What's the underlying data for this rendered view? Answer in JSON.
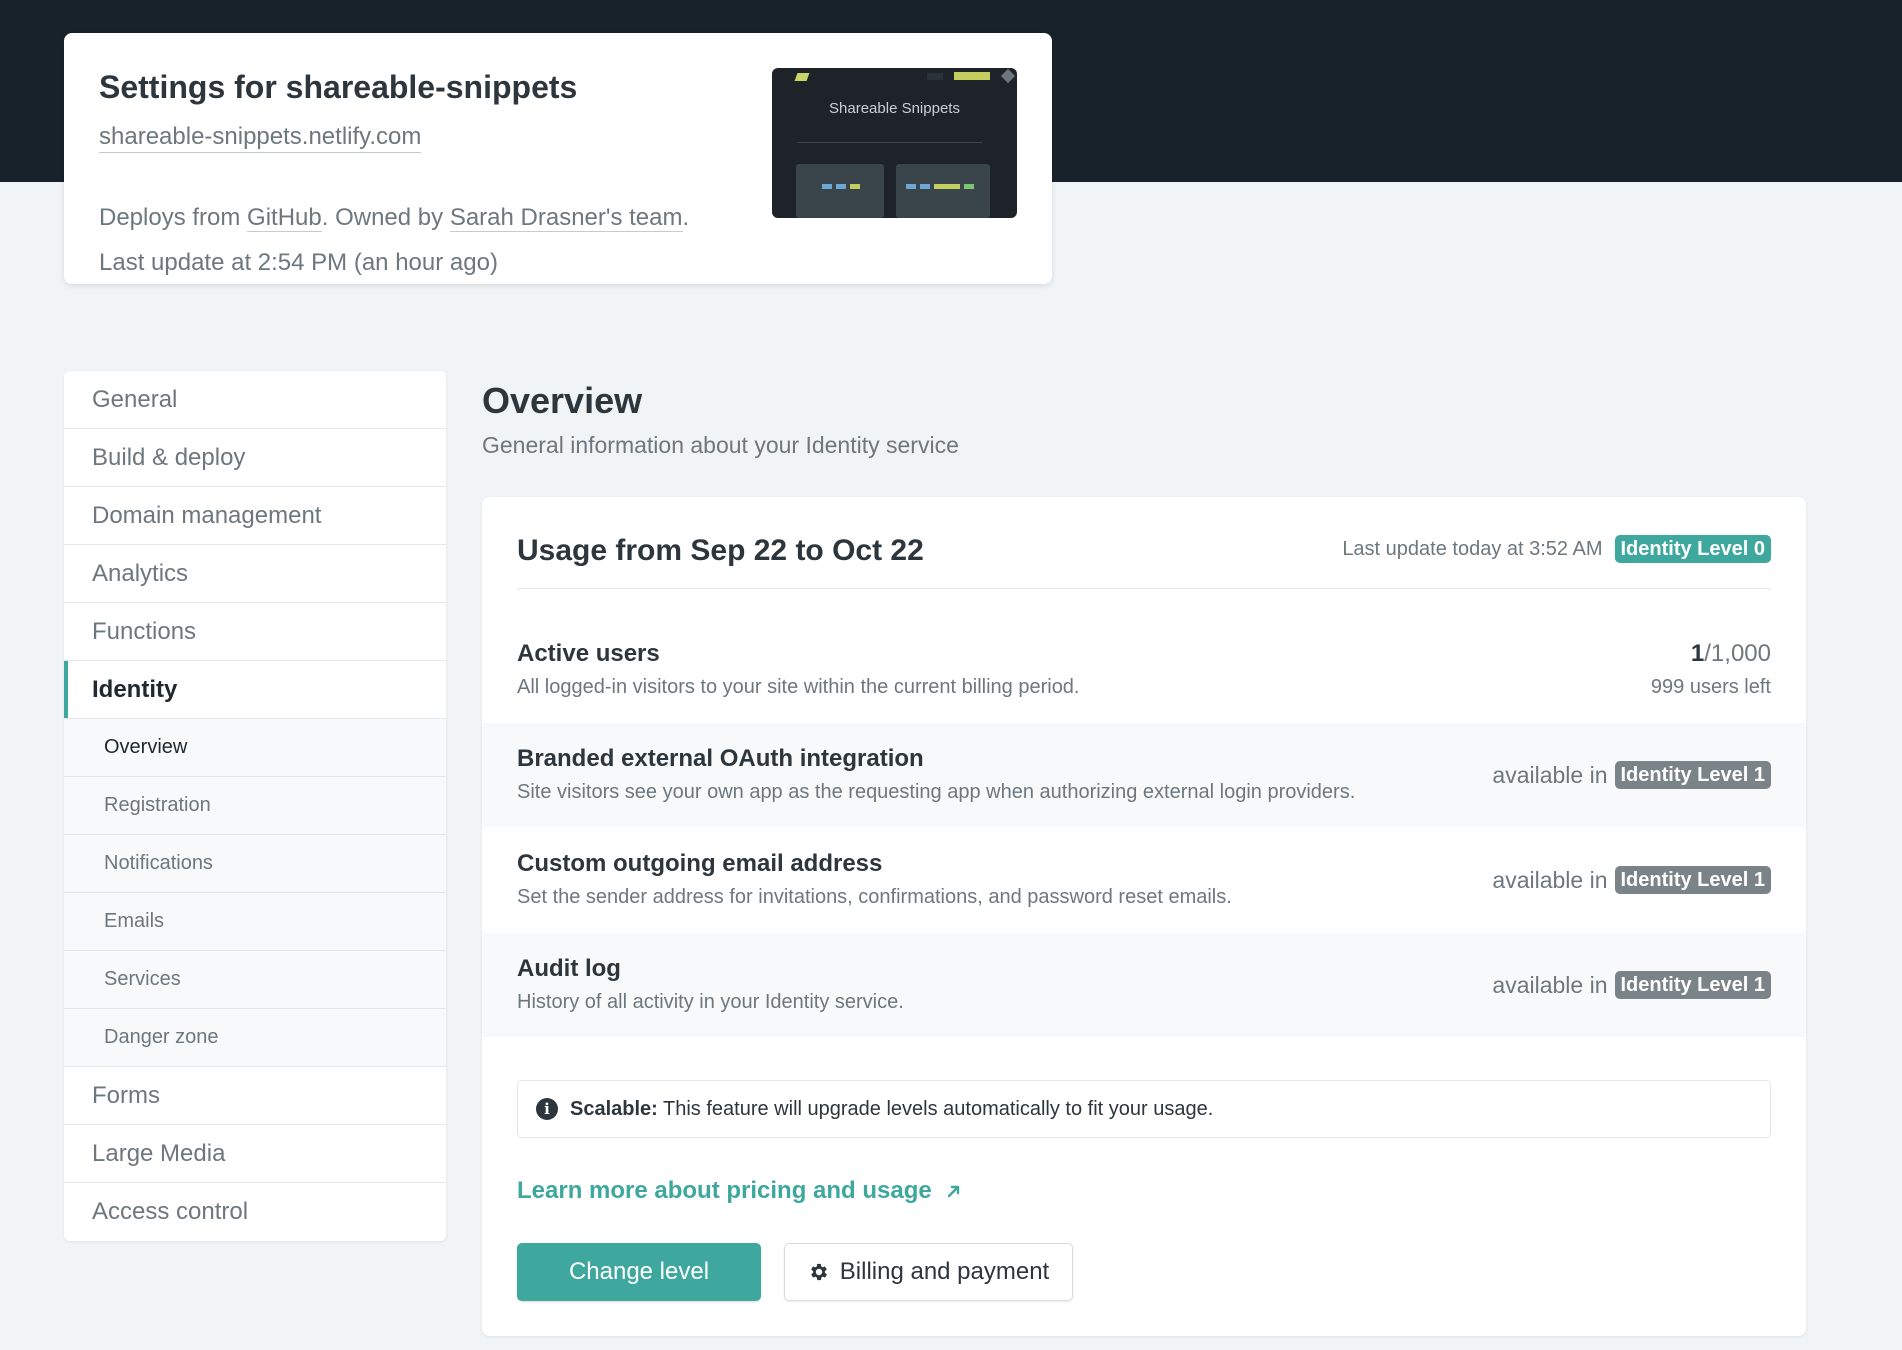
{
  "site": {
    "title": "Settings for shareable-snippets",
    "url": "shareable-snippets.netlify.com",
    "deploys_prefix": "Deploys from ",
    "deploys_source": "GitHub",
    "owned_prefix": ". Owned by ",
    "owner": "Sarah Drasner's team",
    "owned_suffix": ".",
    "last_update": "Last update at 2:54 PM (an hour ago)",
    "thumbnail": {
      "title": "Shareable Snippets"
    }
  },
  "sidebar": {
    "items": [
      {
        "label": "General"
      },
      {
        "label": "Build & deploy"
      },
      {
        "label": "Domain management"
      },
      {
        "label": "Analytics"
      },
      {
        "label": "Functions"
      },
      {
        "label": "Identity"
      }
    ],
    "sub_items": [
      {
        "label": "Overview"
      },
      {
        "label": "Registration"
      },
      {
        "label": "Notifications"
      },
      {
        "label": "Emails"
      },
      {
        "label": "Services"
      },
      {
        "label": "Danger zone"
      }
    ],
    "items_after": [
      {
        "label": "Forms"
      },
      {
        "label": "Large Media"
      },
      {
        "label": "Access control"
      }
    ]
  },
  "main": {
    "title": "Overview",
    "description": "General information about your Identity service"
  },
  "usage": {
    "title": "Usage from Sep 22 to Oct 22",
    "last_update": "Last update today at 3:52 AM",
    "level_badge": "Identity Level 0",
    "active_users": {
      "title": "Active users",
      "description": "All logged-in visitors to your site within the current billing period.",
      "used": "1",
      "limit": "/1,000",
      "remaining": "999 users left"
    },
    "features": [
      {
        "title": "Branded external OAuth integration",
        "description": "Site visitors see your own app as the requesting app when authorizing external login providers.",
        "available_in": "available in",
        "level": "Identity Level 1"
      },
      {
        "title": "Custom outgoing email address",
        "description": "Set the sender address for invitations, confirmations, and password reset emails.",
        "available_in": "available in",
        "level": "Identity Level 1"
      },
      {
        "title": "Audit log",
        "description": "History of all activity in your Identity service.",
        "available_in": "available in",
        "level": "Identity Level 1"
      }
    ],
    "notice": {
      "label": "Scalable:",
      "text": " This feature will upgrade levels automatically to fit your usage."
    },
    "learn_link": "Learn more about pricing and usage",
    "change_level_button": "Change level",
    "billing_button": "Billing and payment"
  },
  "colors": {
    "accent": "#3ea79e",
    "header_bg": "#18222b",
    "page_bg": "#f1f4f6"
  }
}
